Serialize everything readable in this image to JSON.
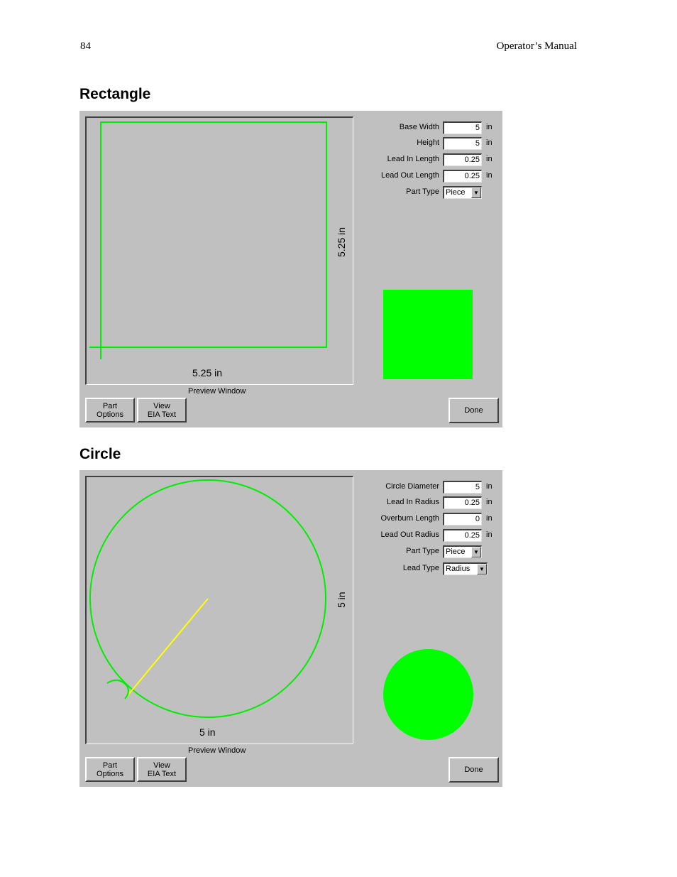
{
  "header": {
    "page_number": "84",
    "title": "Operator’s Manual"
  },
  "rectangle": {
    "heading": "Rectangle",
    "preview_label": "Preview Window",
    "dim_width": "5.25 in",
    "dim_height": "5.25 in",
    "fields": [
      {
        "label": "Base Width",
        "value": "5",
        "unit": "in"
      },
      {
        "label": "Height",
        "value": "5",
        "unit": "in"
      },
      {
        "label": "Lead In Length",
        "value": "0.25",
        "unit": "in"
      },
      {
        "label": "Lead Out Length",
        "value": "0.25",
        "unit": "in"
      }
    ],
    "part_type": {
      "label": "Part Type",
      "value": "Piece"
    },
    "buttons": {
      "part_options_1": "Part",
      "part_options_2": "Options",
      "view_1": "View",
      "view_2": "EIA Text",
      "done": "Done"
    },
    "colors": {
      "path": "#00ee00",
      "swatch": "#00ff00"
    }
  },
  "circle": {
    "heading": "Circle",
    "preview_label": "Preview Window",
    "dim_width": "5 in",
    "dim_height": "5 in",
    "fields": [
      {
        "label": "Circle Diameter",
        "value": "5",
        "unit": "in"
      },
      {
        "label": "Lead In Radius",
        "value": "0.25",
        "unit": "in"
      },
      {
        "label": "Overburn Length",
        "value": "0",
        "unit": "in"
      },
      {
        "label": "Lead Out Radius",
        "value": "0.25",
        "unit": "in"
      }
    ],
    "part_type": {
      "label": "Part Type",
      "value": "Piece"
    },
    "lead_type": {
      "label": "Lead Type",
      "value": "Radius"
    },
    "buttons": {
      "part_options_1": "Part",
      "part_options_2": "Options",
      "view_1": "View",
      "view_2": "EIA Text",
      "done": "Done"
    },
    "colors": {
      "path": "#00ee00",
      "lead": "#ffff00",
      "swatch": "#00ff00"
    }
  }
}
